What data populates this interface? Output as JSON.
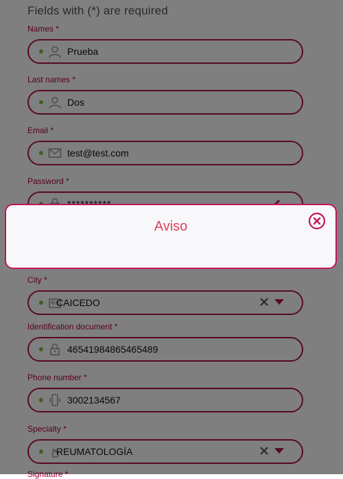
{
  "form": {
    "required_note": "Fields with (*) are required",
    "fields": {
      "names": {
        "label": "Names *",
        "value": "Prueba",
        "icon": "user-icon"
      },
      "last_names": {
        "label": "Last names *",
        "value": "Dos",
        "icon": "user-icon"
      },
      "email": {
        "label": "Email *",
        "value": "test@test.com",
        "icon": "envelope-icon"
      },
      "password": {
        "label": "Password *",
        "value": "**********",
        "icon": "lock-icon"
      },
      "city": {
        "label": "City *",
        "value": "CAICEDO",
        "icon": "id-card-icon"
      },
      "identification": {
        "label": "Identification document *",
        "value": "46541984865465489",
        "icon": "lock-icon"
      },
      "phone": {
        "label": "Phone number *",
        "value": "3002134567",
        "icon": "phone-icon"
      },
      "specialty": {
        "label": "Specialty *",
        "value": "REUMATOLOGÍA",
        "icon": "hand-icon"
      },
      "signature": {
        "label": "Signature *"
      }
    }
  },
  "modal": {
    "title": "Aviso",
    "close_icon": "close-circle-icon"
  },
  "colors": {
    "accent": "#b0124f",
    "label": "#b0003a",
    "dot": "#7ac143",
    "modal_title": "#e0405a"
  }
}
